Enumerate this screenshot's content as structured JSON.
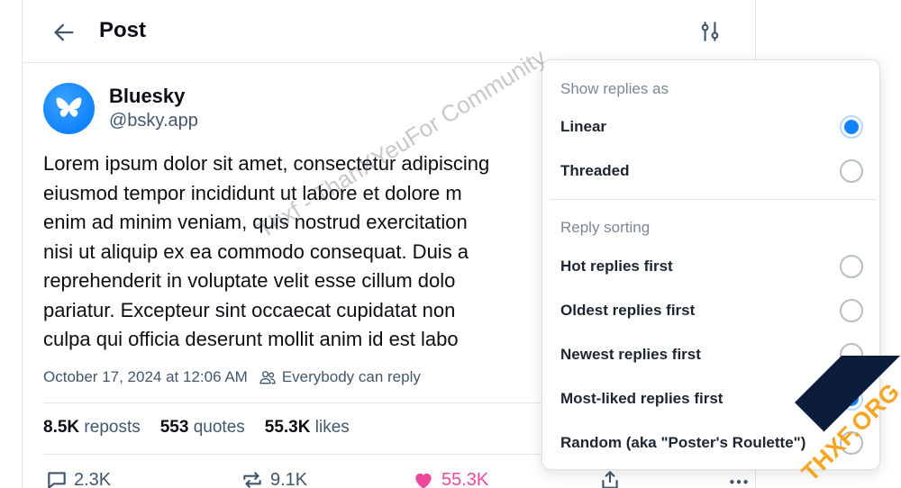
{
  "header": {
    "title": "Post"
  },
  "post": {
    "author_name": "Bluesky",
    "handle": "@bsky.app",
    "lines": [
      "Lorem ipsum dolor sit amet, consectetur adipiscing",
      "eiusmod tempor incididunt ut labore et dolore m",
      "enim ad minim veniam, quis nostrud exercitation",
      "nisi ut aliquip ex ea commodo consequat. Duis a",
      "reprehenderit in voluptate velit esse cillum dolo",
      "pariatur. Excepteur sint occaecat cupidatat non",
      "culpa qui officia deserunt mollit anim id est labo"
    ],
    "timestamp": "October 17, 2024 at 12:06 AM",
    "reply_setting": "Everybody can reply",
    "stats": {
      "reposts_count": "8.5K",
      "reposts_label": "reposts",
      "quotes_count": "553",
      "quotes_label": "quotes",
      "likes_count": "55.3K",
      "likes_label": "likes"
    },
    "actions": {
      "replies": "2.3K",
      "reposts": "9.1K",
      "likes": "55.3K"
    }
  },
  "menu": {
    "show_title": "Show replies as",
    "show_options": [
      {
        "label": "Linear",
        "selected": true
      },
      {
        "label": "Threaded",
        "selected": false
      }
    ],
    "sort_title": "Reply sorting",
    "sort_options": [
      {
        "label": "Hot replies first",
        "selected": false
      },
      {
        "label": "Oldest replies first",
        "selected": false
      },
      {
        "label": "Newest replies first",
        "selected": false
      },
      {
        "label": "Most-liked replies first",
        "selected": true
      },
      {
        "label": "Random (aka \"Poster's Roulette\")",
        "selected": false
      }
    ]
  },
  "overlay": {
    "watermark": "Thxf - ThanXYeuFor Community",
    "badge": "THXF.ORG"
  },
  "colors": {
    "accent": "#1083fe",
    "like": "#ec4899",
    "muted": "#42576c",
    "border": "#e3e6ea"
  }
}
